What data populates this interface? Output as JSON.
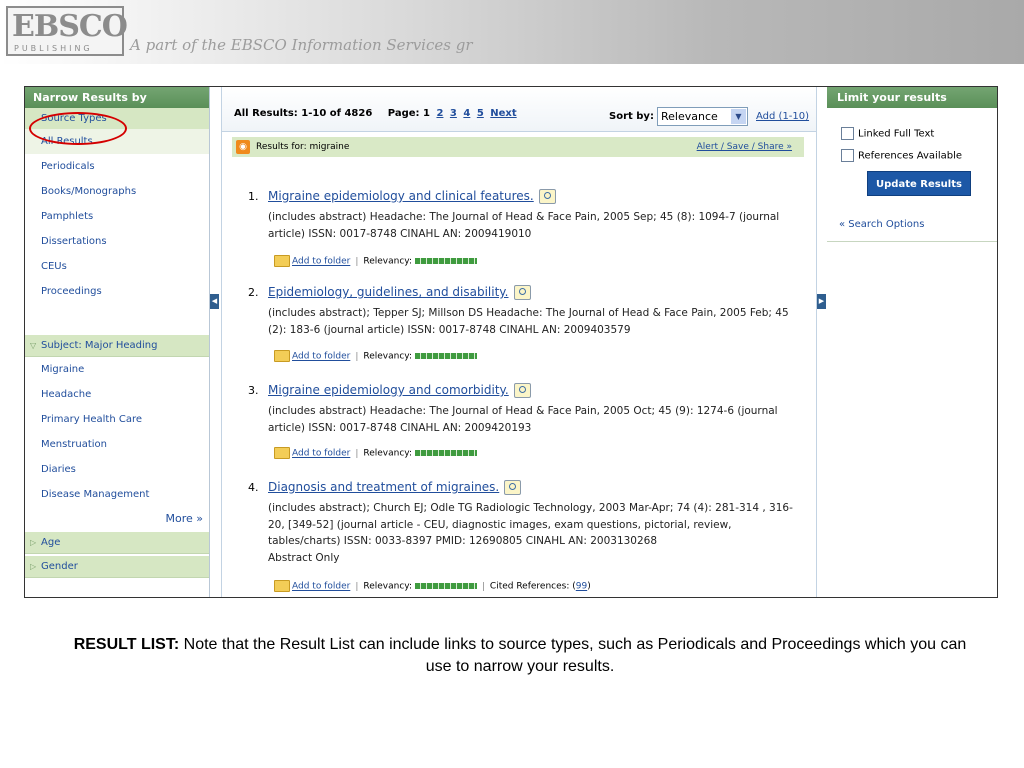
{
  "banner": {
    "logo_main": "EBSCO",
    "logo_sub": "PUBLISHING",
    "tagline": "A part of the EBSCO Information Services gr"
  },
  "left_panel": {
    "header": "Narrow Results by",
    "source_types": {
      "header": "Source Types",
      "items": [
        "All Results",
        "Periodicals",
        "Books/Monographs",
        "Pamphlets",
        "Dissertations",
        "CEUs",
        "Proceedings"
      ]
    },
    "subject": {
      "header": "Subject: Major Heading",
      "items": [
        "Migraine",
        "Headache",
        "Primary Health Care",
        "Menstruation",
        "Diaries",
        "Disease Management"
      ],
      "more": "More »"
    },
    "age": "Age",
    "gender": "Gender"
  },
  "results_header": {
    "summary": "All Results: 1-10 of 4826",
    "page_label": "Page: 1",
    "pages": [
      "2",
      "3",
      "4",
      "5"
    ],
    "next": "Next",
    "sort_label": "Sort by:",
    "sort_value": "Relevance",
    "add_link": "Add (1-10)"
  },
  "results_for": {
    "label": "Results for: migraine",
    "alert_link": "Alert / Save / Share »"
  },
  "results": [
    {
      "num": "1.",
      "title": "Migraine epidemiology and clinical features.",
      "desc": "(includes abstract) Headache: The Journal of Head & Face Pain, 2005 Sep; 45 (8): 1094-7 (journal article) ISSN: 0017-8748 CINAHL AN: 2009419010",
      "folder": "Add to folder",
      "relevancy": "Relevancy:"
    },
    {
      "num": "2.",
      "title": "Epidemiology, guidelines, and disability.",
      "desc": "(includes abstract); Tepper SJ; Millson DS Headache: The Journal of Head & Face Pain, 2005 Feb; 45 (2): 183-6 (journal article) ISSN: 0017-8748 CINAHL AN: 2009403579",
      "folder": "Add to folder",
      "relevancy": "Relevancy:"
    },
    {
      "num": "3.",
      "title": "Migraine epidemiology and comorbidity.",
      "desc": "(includes abstract) Headache: The Journal of Head & Face Pain, 2005 Oct; 45 (9): 1274-6 (journal article) ISSN: 0017-8748 CINAHL AN: 2009420193",
      "folder": "Add to folder",
      "relevancy": "Relevancy:"
    },
    {
      "num": "4.",
      "title": "Diagnosis and treatment of migraines.",
      "desc": "(includes abstract); Church EJ; Odle TG Radiologic Technology, 2003 Mar-Apr; 74 (4): 281-314 , 316-20, [349-52] (journal article - CEU, diagnostic images, exam questions, pictorial, review, tables/charts) ISSN: 0033-8397 PMID: 12690805 CINAHL AN: 2003130268",
      "extra": "Abstract Only",
      "folder": "Add to folder",
      "relevancy": "Relevancy:",
      "cited_label": "Cited References: (",
      "cited_count": "99",
      "cited_close": ")"
    }
  ],
  "right_panel": {
    "header": "Limit your results",
    "linked_full_text": "Linked Full Text",
    "references_available": "References Available",
    "update_button": "Update Results",
    "search_options": "« Search Options"
  },
  "caption": {
    "bold": "RESULT LIST:",
    "text": " Note that the Result List can include links to source types, such as Periodicals and Proceedings which you can use to narrow your results."
  },
  "colors": {
    "header_green": "#5a8f58",
    "facet_green": "#d6e7c3",
    "link_blue": "#214e9c",
    "button_blue": "#1d58a6",
    "highlight_red": "#d40000"
  }
}
